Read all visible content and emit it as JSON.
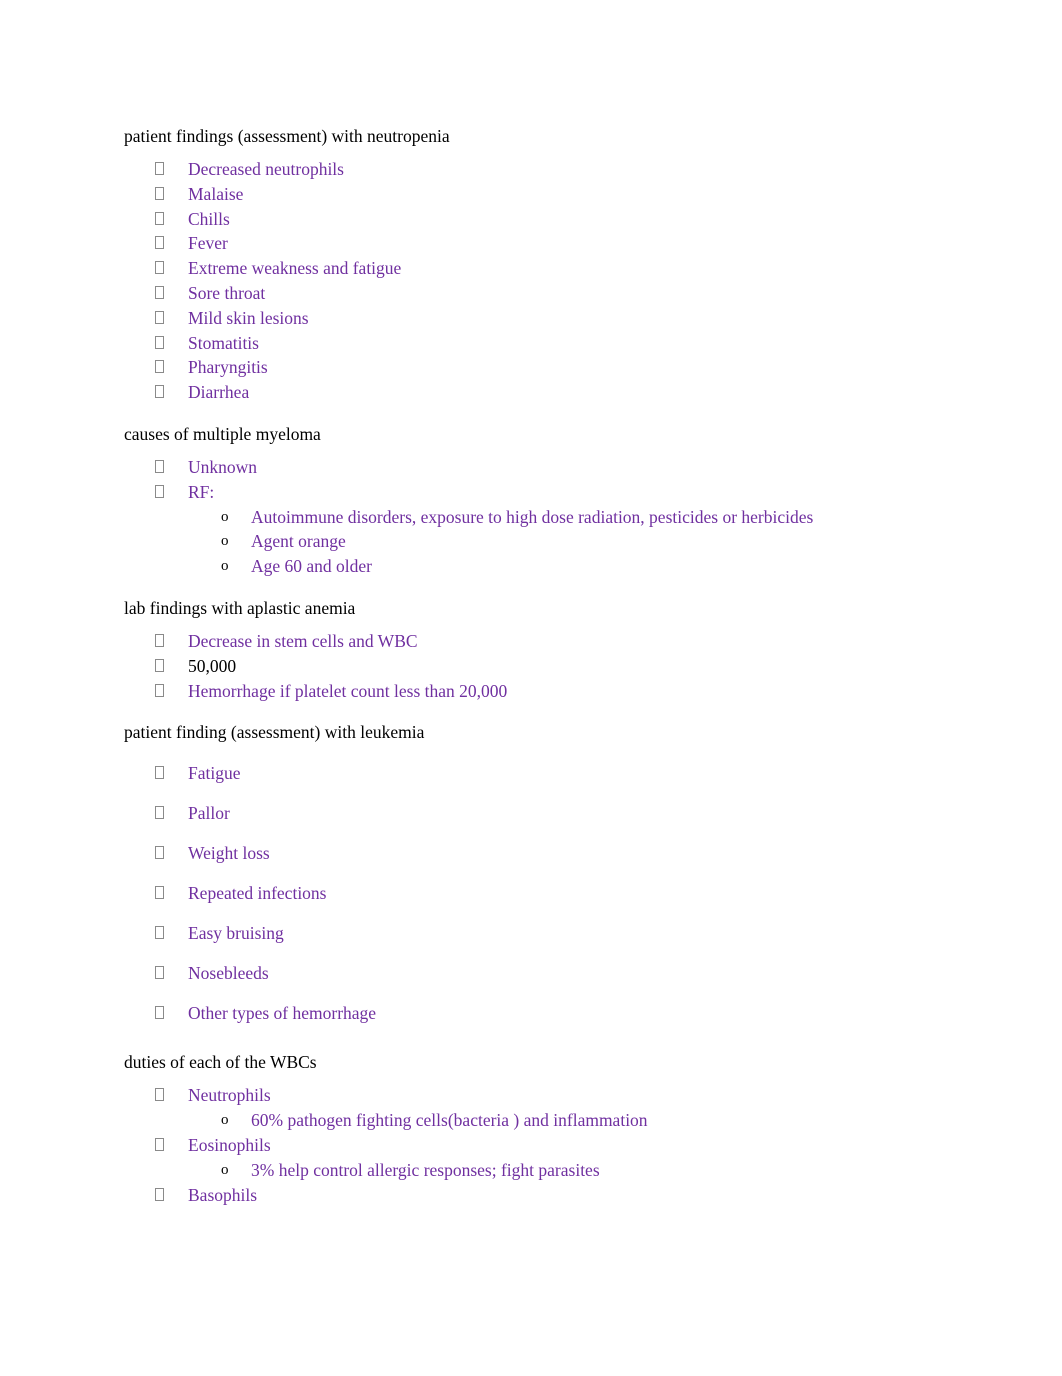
{
  "document": {
    "colors": {
      "body_text": "#000000",
      "list_text": "#7030A0",
      "highlight": "#fdf33a",
      "page_background": "#ffffff"
    },
    "sections": [
      {
        "heading": "patient findings (assessment) with neutropenia",
        "items": [
          {
            "text": "Decreased neutrophils"
          },
          {
            "text": "Malaise"
          },
          {
            "text": "Chills"
          },
          {
            "text": "Fever"
          },
          {
            "text": "Extreme weakness and fatigue"
          },
          {
            "text": "Sore throat"
          },
          {
            "text": "Mild skin lesions"
          },
          {
            "text": "Stomatitis"
          },
          {
            "text": "Pharyngitis"
          },
          {
            "text": "Diarrhea"
          }
        ]
      },
      {
        "heading": "causes of multiple myeloma",
        "items": [
          {
            "text": "Unknown"
          },
          {
            "text": "RF:"
          }
        ],
        "subitems": [
          {
            "text": "Autoimmune disorders, exposure to high dose radiation, pesticides or herbicides"
          },
          {
            "text": "Agent orange"
          },
          {
            "text": "Age 60 and older"
          }
        ]
      },
      {
        "heading": "lab findings with aplastic anemia",
        "items": [
          {
            "text": "Decrease in stem cells and WBC"
          },
          {
            "text": "50,000"
          },
          {
            "text": "Hemorrhage if platelet count less than 20,000"
          }
        ]
      },
      {
        "heading": "patient finding (assessment) with leukemia",
        "items": [
          {
            "text": "Fatigue"
          },
          {
            "text": "Pallor"
          },
          {
            "text": "Weight loss"
          },
          {
            "text": "Repeated infections"
          },
          {
            "text": "Easy bruising"
          },
          {
            "text": "Nosebleeds"
          },
          {
            "text": "Other types of hemorrhage"
          }
        ]
      },
      {
        "heading": "duties of each of the WBCs",
        "items": [
          {
            "text": "Neutrophils"
          },
          {
            "text": "Eosinophils"
          },
          {
            "text": "Basophils"
          }
        ],
        "subitems": [
          {
            "segments": {
              "before": "60% pathogen fighting cells",
              "highlight": "(bacteria ",
              "after": ") and inflammation"
            }
          },
          {
            "segments": {
              "before": "3% help control ",
              "highlight": "allergic",
              "middle": " responses; fight",
              "highlight2": " parasites"
            }
          }
        ]
      }
    ]
  }
}
